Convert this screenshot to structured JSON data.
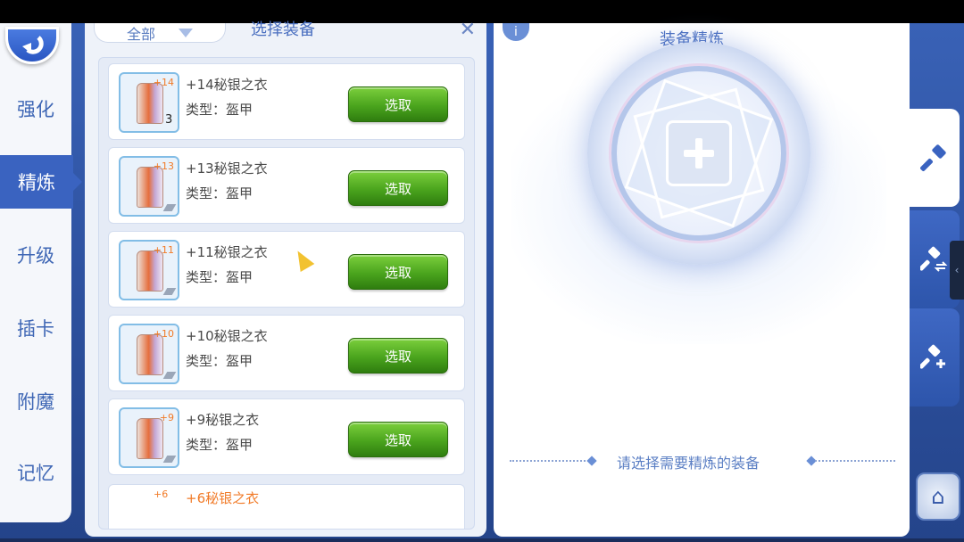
{
  "nav": {
    "items": [
      {
        "label": "强化"
      },
      {
        "label": "精炼"
      },
      {
        "label": "升级"
      },
      {
        "label": "插卡"
      },
      {
        "label": "附魔"
      },
      {
        "label": "记忆"
      }
    ],
    "active": "精炼"
  },
  "list_panel": {
    "filter_value": "全部",
    "title": "选择装备",
    "items": [
      {
        "badge": "+14",
        "name": "+14秘银之衣",
        "type": "类型：盔甲",
        "count": "3",
        "button": "选取"
      },
      {
        "badge": "+13",
        "name": "+13秘银之衣",
        "type": "类型：盔甲",
        "count": "",
        "button": "选取"
      },
      {
        "badge": "+11",
        "name": "+11秘银之衣",
        "type": "类型：盔甲",
        "count": "",
        "button": "选取"
      },
      {
        "badge": "+10",
        "name": "+10秘银之衣",
        "type": "类型：盔甲",
        "count": "",
        "button": "选取"
      },
      {
        "badge": "+9",
        "name": "+9秘银之衣",
        "type": "类型：盔甲",
        "count": "",
        "button": "选取"
      }
    ],
    "partial_item": {
      "badge": "+6",
      "name": "+6秘银之衣"
    }
  },
  "refine_panel": {
    "info_icon": "i",
    "title": "装备精炼",
    "prompt": "请选择需要精炼的装备"
  },
  "colors": {
    "accent": "#3a63c0",
    "select_button": "#4aa41d",
    "refine_badge": "#f17b28"
  },
  "icons": [
    "back-arrow-icon",
    "close-icon",
    "plus-icon",
    "hammer-icon",
    "hammer-swap-icon",
    "hammer-add-icon",
    "shop-icon",
    "cursor-icon"
  ]
}
